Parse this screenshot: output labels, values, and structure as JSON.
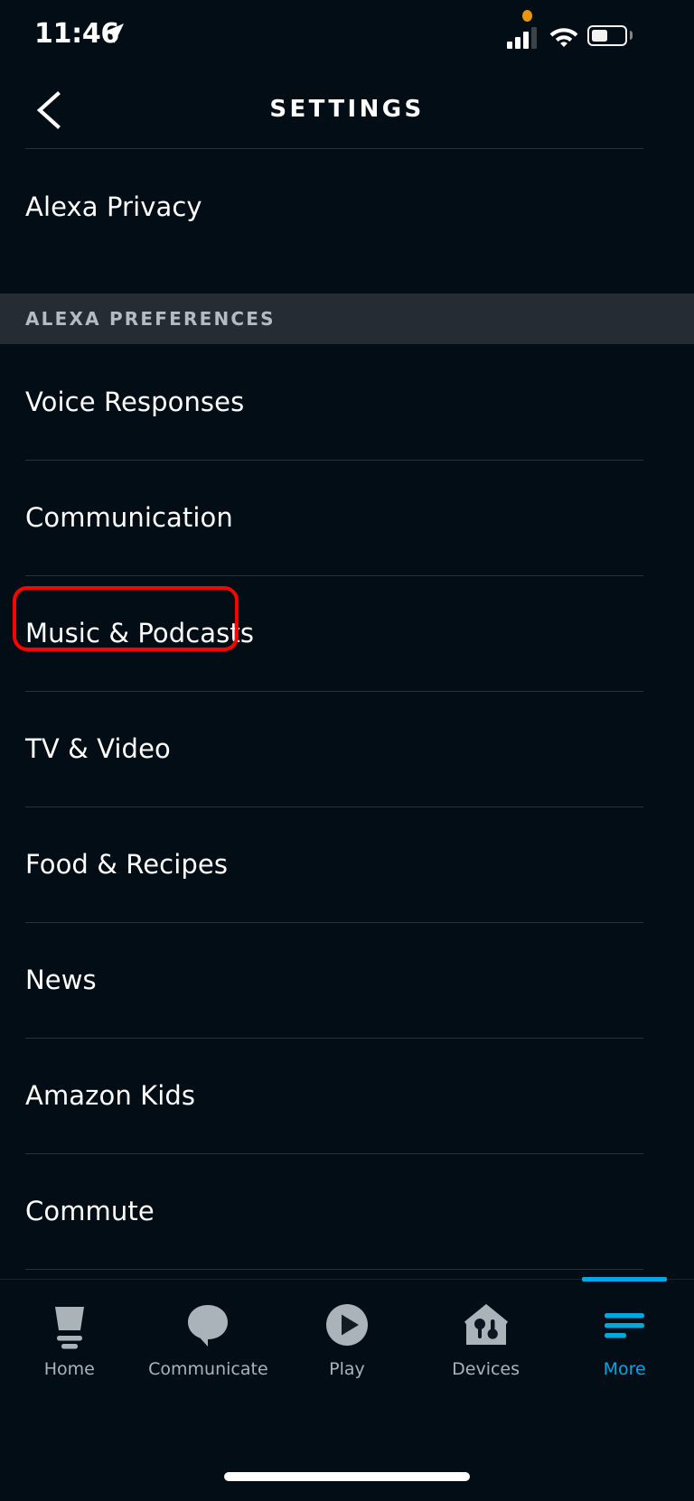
{
  "status_bar": {
    "time": "11:46",
    "location_icon": "location-arrow-icon",
    "privacy_indicator": "orange-privacy-dot",
    "cellular_icon": "cellular-signal-icon",
    "cellular_bars_filled": 3,
    "cellular_bars_total": 4,
    "wifi_icon": "wifi-icon",
    "battery_icon": "battery-icon",
    "battery_percent": 42
  },
  "header": {
    "back_icon": "chevron-left-icon",
    "title": "SETTINGS"
  },
  "top_section": {
    "items": [
      {
        "label": "Alexa Privacy"
      }
    ]
  },
  "alexa_preferences": {
    "section_title": "ALEXA PREFERENCES",
    "items": [
      {
        "label": "Voice Responses"
      },
      {
        "label": "Communication"
      },
      {
        "label": "Music & Podcasts"
      },
      {
        "label": "TV & Video"
      },
      {
        "label": "Food & Recipes"
      },
      {
        "label": "News"
      },
      {
        "label": "Amazon Kids"
      },
      {
        "label": "Commute"
      }
    ]
  },
  "annotation": {
    "target_label": "Music & Podcasts",
    "color": "#ff0000"
  },
  "tab_bar": {
    "active_tab": "More",
    "items": [
      {
        "label": "Home",
        "icon": "echo-device-icon",
        "active": false
      },
      {
        "label": "Communicate",
        "icon": "speech-bubble-icon",
        "active": false
      },
      {
        "label": "Play",
        "icon": "play-circle-icon",
        "active": false
      },
      {
        "label": "Devices",
        "icon": "smart-home-icon",
        "active": false
      },
      {
        "label": "More",
        "icon": "menu-lines-icon",
        "active": true
      }
    ]
  },
  "colors": {
    "background": "#030d15",
    "section_header_bg": "#262c33",
    "divider": "#2a3138",
    "accent_blue": "#00a8e1",
    "text_primary": "#ffffff",
    "text_muted": "#aab3ba",
    "annotation_red": "#ff0000",
    "privacy_orange": "#e8960c"
  }
}
